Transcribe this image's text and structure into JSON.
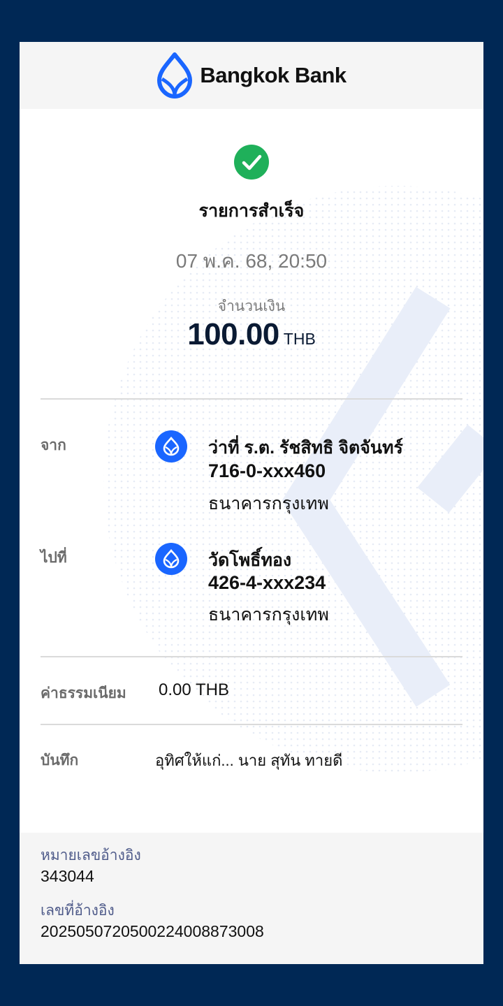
{
  "header": {
    "brand_name": "Bangkok Bank",
    "logo_icon": "bangkok-bank-logo",
    "brand_color": "#1a66ff"
  },
  "status": {
    "icon": "check-circle-icon",
    "text": "รายการสำเร็จ",
    "color": "#1fb05a"
  },
  "datetime": "07 พ.ค. 68, 20:50",
  "amount": {
    "label": "จำนวนเงิน",
    "value": "100.00",
    "currency": "THB"
  },
  "from": {
    "label": "จาก",
    "icon": "bangkok-bank-icon",
    "name": "ว่าที่ ร.ต. รัชสิทธิ จิตจันทร์",
    "account": "716-0-xxx460",
    "bank": "ธนาคารกรุงเทพ"
  },
  "to": {
    "label": "ไปที่",
    "icon": "bangkok-bank-icon",
    "name": "วัดโพธิ์ทอง",
    "account": "426-4-xxx234",
    "bank": "ธนาคารกรุงเทพ"
  },
  "fee": {
    "label": "ค่าธรรมเนียม",
    "value": "0.00 THB"
  },
  "note": {
    "label": "บันทึก",
    "value": "อุทิศให้แก่...  นาย สุทัน ทายดี"
  },
  "reference": {
    "ref_number_label": "หมายเลขอ้างอิง",
    "ref_number": "343044",
    "ref_code_label": "เลขที่อ้างอิง",
    "ref_code": "2025050720500224008873008"
  }
}
